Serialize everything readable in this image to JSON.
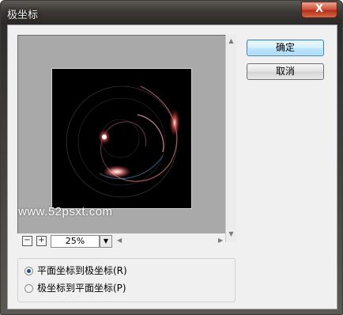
{
  "window": {
    "title": "极坐标",
    "close_glyph": "X"
  },
  "preview": {
    "watermark": "www.52psxt.com",
    "zoom_minus": "−",
    "zoom_plus": "+",
    "zoom_value": "25%",
    "zoom_dropdown_icon": "▼",
    "scroll_up_icon": "▲",
    "scroll_down_icon": "▼",
    "scroll_left_icon": "◀",
    "scroll_right_icon": "▶"
  },
  "buttons": {
    "ok": "确定",
    "cancel": "取消"
  },
  "options": {
    "selected": 0,
    "items": [
      {
        "label": "平面坐标到极坐标(R)",
        "checked": true
      },
      {
        "label": "极坐标到平面坐标(P)",
        "checked": false
      }
    ]
  },
  "colors": {
    "accent": "#3c7fb1",
    "preview_bg": "#a9a9a9",
    "close_red": "#c9452a"
  }
}
